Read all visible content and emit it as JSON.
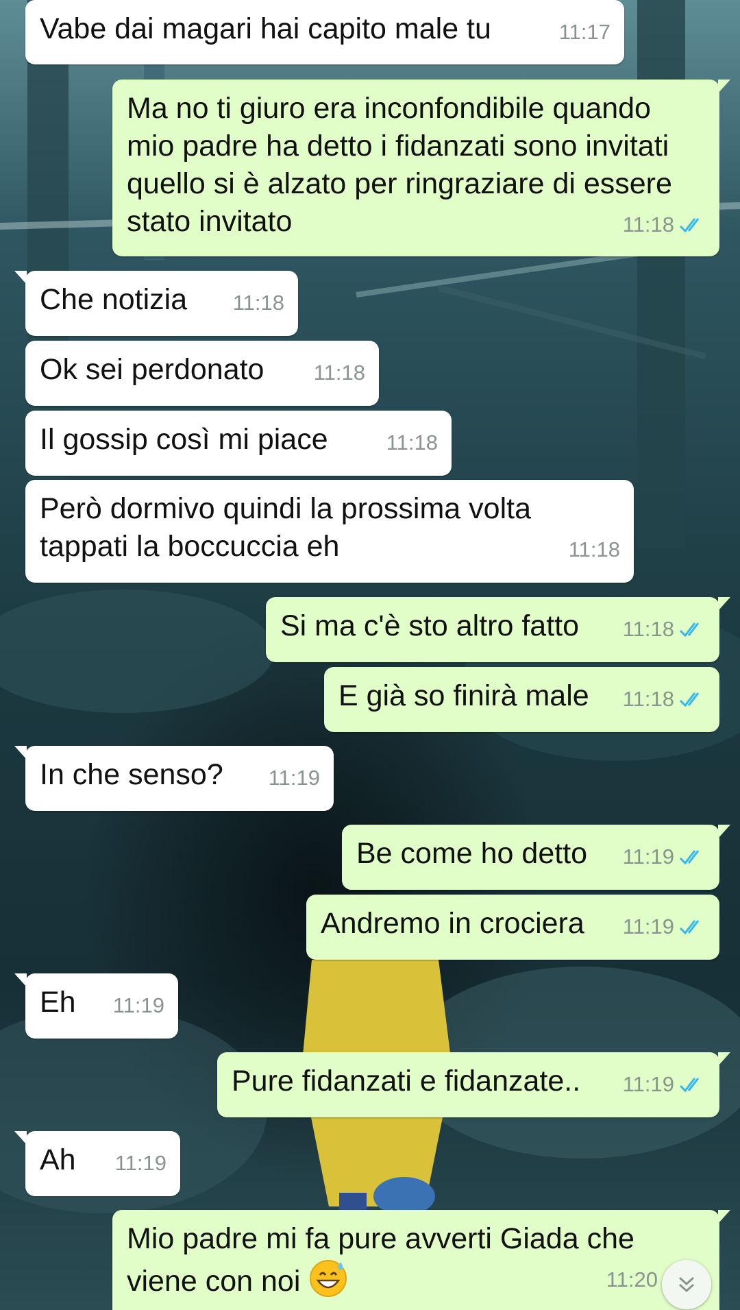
{
  "chat": {
    "messages": [
      {
        "dir": "in",
        "tail": false,
        "text": "Vabe dai magari hai capito male tu",
        "time": "11:17"
      },
      {
        "dir": "out",
        "tail": true,
        "text": "Ma no ti giuro era inconfondibile quando mio padre ha detto i fidanzati sono invitati quello si è alzato per ringraziare di essere stato invitato",
        "time": "11:18",
        "read": true
      },
      {
        "dir": "in",
        "tail": true,
        "text": "Che notizia",
        "time": "11:18"
      },
      {
        "dir": "in",
        "tail": false,
        "text": "Ok sei perdonato",
        "time": "11:18"
      },
      {
        "dir": "in",
        "tail": false,
        "text": "Il gossip così mi piace",
        "time": "11:18"
      },
      {
        "dir": "in",
        "tail": false,
        "text": "Però dormivo quindi la prossima volta tappati la boccuccia eh",
        "time": "11:18"
      },
      {
        "dir": "out",
        "tail": true,
        "text": "Si ma c'è sto altro fatto",
        "time": "11:18",
        "read": true
      },
      {
        "dir": "out",
        "tail": false,
        "text": "E già so finirà male",
        "time": "11:18",
        "read": true
      },
      {
        "dir": "in",
        "tail": true,
        "text": "In che senso?",
        "time": "11:19"
      },
      {
        "dir": "out",
        "tail": true,
        "text": "Be come ho detto",
        "time": "11:19",
        "read": true
      },
      {
        "dir": "out",
        "tail": false,
        "text": "Andremo in crociera",
        "time": "11:19",
        "read": true
      },
      {
        "dir": "in",
        "tail": true,
        "text": "Eh",
        "time": "11:19"
      },
      {
        "dir": "out",
        "tail": true,
        "text": "Pure fidanzati e fidanzate..",
        "time": "11:19",
        "read": true
      },
      {
        "dir": "in",
        "tail": true,
        "text": "Ah",
        "time": "11:19"
      },
      {
        "dir": "out",
        "tail": true,
        "text": "Mio padre mi fa pure avverti Giada che viene con noi",
        "emoji": "grinning-face-with-sweat",
        "time": "11:20",
        "read": true
      }
    ],
    "scroll_button_icon": "chevron-double-down-icon",
    "colors": {
      "incoming_bubble": "#ffffff",
      "outgoing_bubble": "#e1fdc8",
      "read_ticks": "#34b7f1",
      "timestamp": "#8a948e"
    }
  }
}
